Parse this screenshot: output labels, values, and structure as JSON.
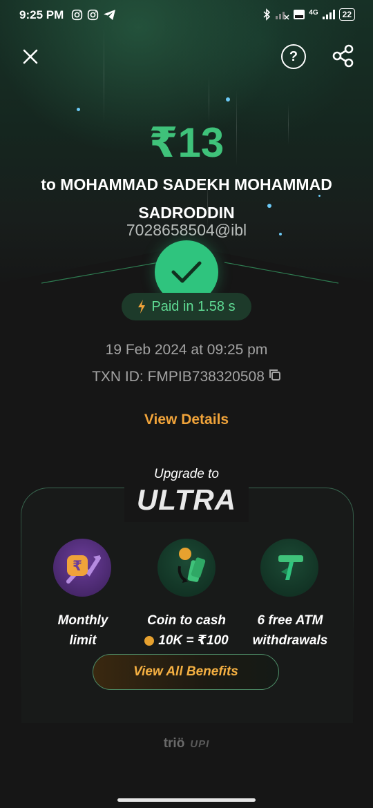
{
  "status_bar": {
    "time": "9:25 PM",
    "network": "4G",
    "battery": "22"
  },
  "header": {
    "close_icon": "close-icon",
    "help_label": "?",
    "share_icon": "share-icon"
  },
  "payment": {
    "amount": "₹13",
    "payee_line": "to MOHAMMAD SADEKH MOHAMMAD SADRODDIN",
    "upi_id": "7028658504@ibl",
    "status_icon": "checkmark-icon",
    "paid_text": "Paid in 1.58 s",
    "date": "19 Feb 2024 at 09:25 pm",
    "txn_id": "TXN ID: FMPIB738320508",
    "view_details": "View Details"
  },
  "upgrade": {
    "heading": "Upgrade to",
    "tier": "ULTRA",
    "benefits": [
      {
        "icon": "rupee-limit-icon",
        "line1": "Monthly",
        "line2": "limit"
      },
      {
        "icon": "coin-to-cash-icon",
        "line1": "Coin to cash",
        "line2": "10K = ₹100"
      },
      {
        "icon": "atm-withdrawal-icon",
        "line1": "6 free ATM",
        "line2": "withdrawals"
      }
    ],
    "cta": "View All Benefits"
  },
  "footer": {
    "brand": "triö",
    "upi": "UPI"
  },
  "colors": {
    "accent_green": "#3fc27a",
    "accent_orange": "#f0a33a",
    "background": "#161616"
  }
}
